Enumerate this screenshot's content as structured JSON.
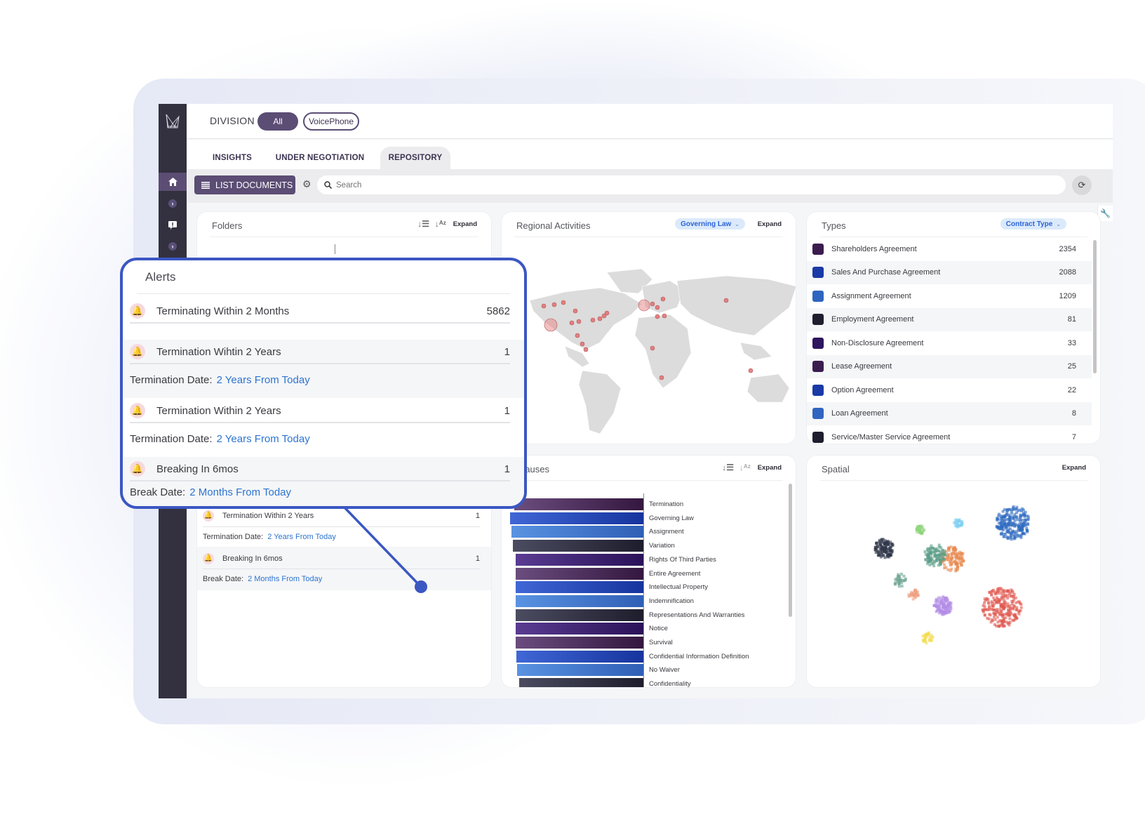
{
  "header": {
    "division_label": "DIVISION",
    "division_options": [
      "All",
      "VoicePhone"
    ],
    "division_selected": "All"
  },
  "tabs": [
    {
      "label": "INSIGHTS",
      "active": false
    },
    {
      "label": "UNDER NEGOTIATION",
      "active": false
    },
    {
      "label": "REPOSITORY",
      "active": true
    }
  ],
  "toolbar": {
    "list_documents_label": "LIST DOCUMENTS",
    "search_placeholder": "Search"
  },
  "icons": {
    "logo": "crown-logo-icon",
    "home": "home-icon",
    "chevron": "chevron-right-icon",
    "alert": "alert-speech-icon",
    "gear": "gear-icon",
    "search": "search-icon",
    "refresh": "refresh-icon",
    "wrench": "wrench-icon",
    "bell": "bell-icon",
    "list": "list-icon"
  },
  "panels": {
    "folders": {
      "title": "Folders",
      "expand": "Expand"
    },
    "regional": {
      "title": "Regional Activities",
      "filter": "Governing Law",
      "expand": "Expand"
    },
    "types": {
      "title": "Types",
      "filter": "Contract Type"
    },
    "clauses": {
      "title": "Clauses",
      "title_visible": "auses",
      "expand": "Expand"
    },
    "spatial": {
      "title": "Spatial",
      "expand": "Expand"
    }
  },
  "types": [
    {
      "label": "Shareholders Agreement",
      "count": "2354",
      "color": "#3b1c4f"
    },
    {
      "label": "Sales And Purchase Agreement",
      "count": "2088",
      "color": "#1a3aa6"
    },
    {
      "label": "Assignment Agreement",
      "count": "1209",
      "color": "#2f65c0"
    },
    {
      "label": "Employment Agreement",
      "count": "81",
      "color": "#1e1e2e"
    },
    {
      "label": "Non-Disclosure Agreement",
      "count": "33",
      "color": "#2e1560"
    },
    {
      "label": "Lease Agreement",
      "count": "25",
      "color": "#3b1c4f"
    },
    {
      "label": "Option Agreement",
      "count": "22",
      "color": "#1a3aa6"
    },
    {
      "label": "Loan Agreement",
      "count": "8",
      "color": "#2f65c0"
    },
    {
      "label": "Service/Master Service Agreement",
      "count": "7",
      "color": "#1e1e2e"
    }
  ],
  "alerts": {
    "title": "Alerts",
    "summary": {
      "label": "Terminating Within 2 Months",
      "count": "5862"
    },
    "items": [
      {
        "label": "Termination Wihtin 2 Years",
        "count": "1",
        "date_label": "Termination Date:",
        "date_value": "2 Years From Today"
      },
      {
        "label": "Termination Within 2 Years",
        "count": "1",
        "date_label": "Termination Date:",
        "date_value": "2 Years From Today"
      },
      {
        "label": "Breaking In 6mos",
        "count": "1",
        "date_label": "Break Date:",
        "date_value": "2 Months From Today"
      }
    ]
  },
  "clauses": [
    {
      "label": "Termination",
      "value": 0.97,
      "palette": "plum"
    },
    {
      "label": "Governing Law",
      "value": 1.0,
      "palette": "royal"
    },
    {
      "label": "Assignment",
      "value": 0.99,
      "palette": "sky"
    },
    {
      "label": "Variation",
      "value": 0.98,
      "palette": "slate"
    },
    {
      "label": "Rights Of Third Parties",
      "value": 0.96,
      "palette": "violet"
    },
    {
      "label": "Entire Agreement",
      "value": 0.96,
      "palette": "plum"
    },
    {
      "label": "Intellectual Property",
      "value": 0.96,
      "palette": "royal"
    },
    {
      "label": "Indemnification",
      "value": 0.96,
      "palette": "sky"
    },
    {
      "label": "Representations And Warranties",
      "value": 0.96,
      "palette": "slate"
    },
    {
      "label": "Notice",
      "value": 0.96,
      "palette": "violet"
    },
    {
      "label": "Survival",
      "value": 0.96,
      "palette": "plum"
    },
    {
      "label": "Confidential Information Definition",
      "value": 0.955,
      "palette": "royal"
    },
    {
      "label": "No Waiver",
      "value": 0.95,
      "palette": "sky"
    },
    {
      "label": "Confidentiality",
      "value": 0.93,
      "palette": "slate"
    }
  ],
  "palettes": {
    "plum": [
      "#6b4d7e",
      "#34173f"
    ],
    "royal": [
      "#4067d6",
      "#16349d"
    ],
    "sky": [
      "#5a93e2",
      "#2f5fb6"
    ],
    "slate": [
      "#4c4c61",
      "#1d1d2c"
    ],
    "violet": [
      "#5a3c92",
      "#2a1158"
    ]
  },
  "regional_markers": [
    {
      "region": "US West Coast",
      "size": "large"
    },
    {
      "region": "UK / Ireland",
      "size": "large"
    },
    {
      "region": "US East",
      "size": "small"
    },
    {
      "region": "Central Europe",
      "size": "small"
    },
    {
      "region": "Russia",
      "size": "small"
    },
    {
      "region": "West Africa",
      "size": "small"
    },
    {
      "region": "South Africa",
      "size": "small"
    },
    {
      "region": "Australia",
      "size": "small"
    },
    {
      "region": "Central America",
      "size": "small"
    }
  ],
  "spatial_clusters": [
    {
      "color": "#2f6bbf",
      "size": "large"
    },
    {
      "color": "#e0574f",
      "size": "large"
    },
    {
      "color": "#e8894f",
      "size": "medium"
    },
    {
      "color": "#5e9f88",
      "size": "medium"
    },
    {
      "color": "#2f3547",
      "size": "medium"
    },
    {
      "color": "#b28ce6",
      "size": "medium"
    },
    {
      "color": "#6aa38f",
      "size": "small"
    },
    {
      "color": "#f3dc4e",
      "size": "small"
    },
    {
      "color": "#eea07f",
      "size": "small"
    },
    {
      "color": "#8ed47a",
      "size": "small"
    },
    {
      "color": "#7fd0f0",
      "size": "small"
    }
  ]
}
